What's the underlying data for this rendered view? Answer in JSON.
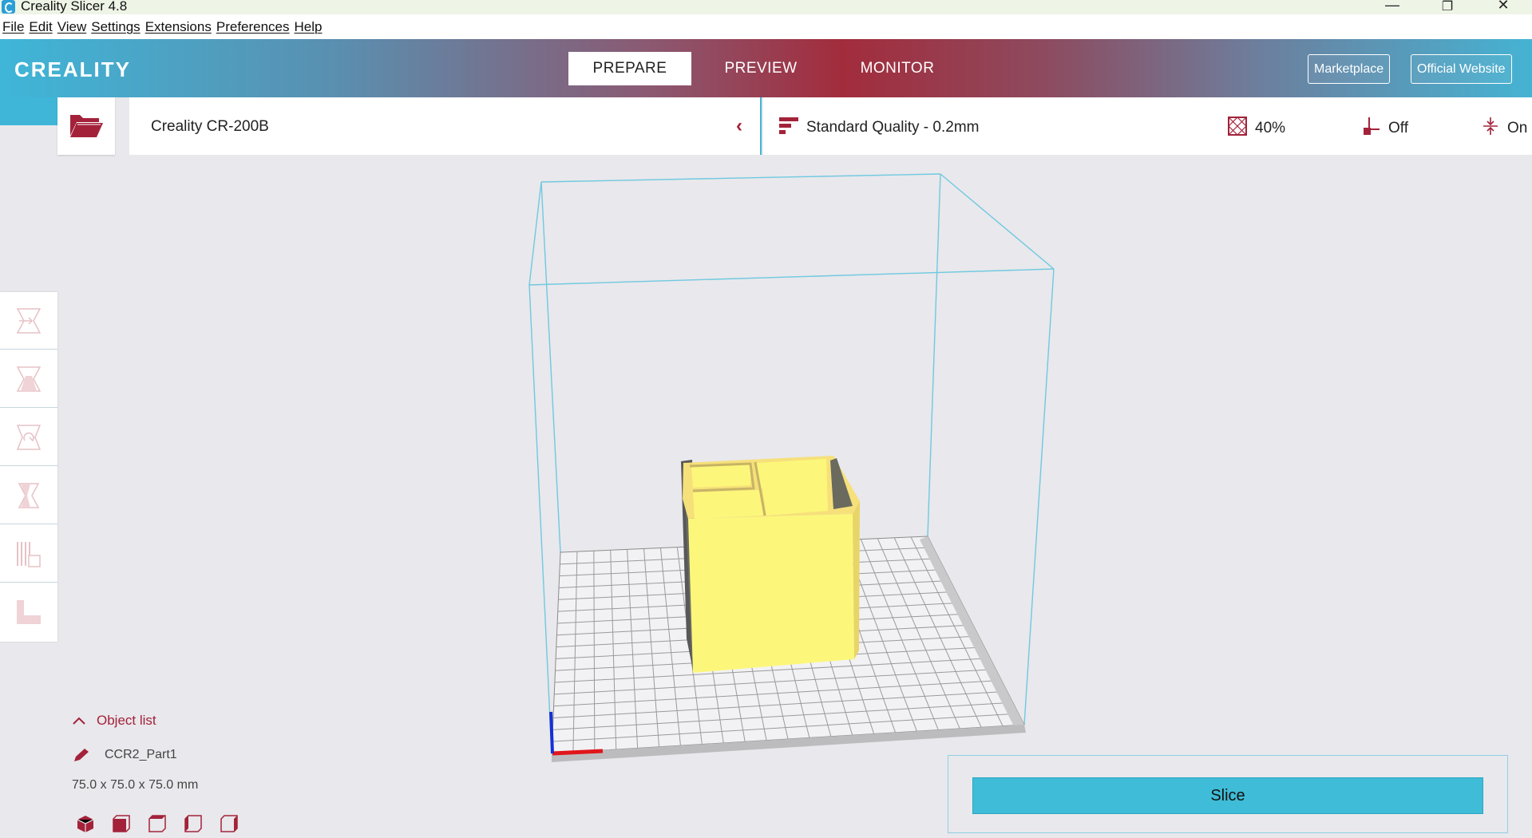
{
  "window": {
    "title": "Creality Slicer 4.8",
    "minimize_glyph": "—",
    "restore_glyph": "❐",
    "close_glyph": "✕"
  },
  "menu": [
    "File",
    "Edit",
    "View",
    "Settings",
    "Extensions",
    "Preferences",
    "Help"
  ],
  "header": {
    "logo": "CREALITY",
    "tabs": [
      {
        "label": "PREPARE",
        "active": true
      },
      {
        "label": "PREVIEW",
        "active": false
      },
      {
        "label": "MONITOR",
        "active": false
      }
    ],
    "links": {
      "marketplace": "Marketplace",
      "official_website": "Official Website"
    }
  },
  "toolbar": {
    "printer": "Creality CR-200B",
    "printer_chevron": "‹",
    "quality": "Standard Quality - 0.2mm",
    "infill": "40%",
    "support": "Off",
    "adhesion": "On"
  },
  "left_tools": [
    "move-tool",
    "scale-tool",
    "rotate-tool",
    "mirror-tool",
    "per-model-settings-tool",
    "support-blocker-tool"
  ],
  "object_list": {
    "toggle_caret": "^",
    "label": "Object list",
    "object_name": "CCR2_Part1",
    "dimensions": "75.0 x 75.0 x 75.0 mm"
  },
  "view_buttons": [
    "3d-view-icon",
    "front-view-icon",
    "top-view-icon",
    "left-view-icon",
    "right-view-icon"
  ],
  "slice": {
    "label": "Slice"
  },
  "colors": {
    "accent_blue": "#3fb6d8",
    "brand_red": "#a3223a",
    "model_yellow": "#fcf77a",
    "build_volume": "#6fc9e0"
  }
}
